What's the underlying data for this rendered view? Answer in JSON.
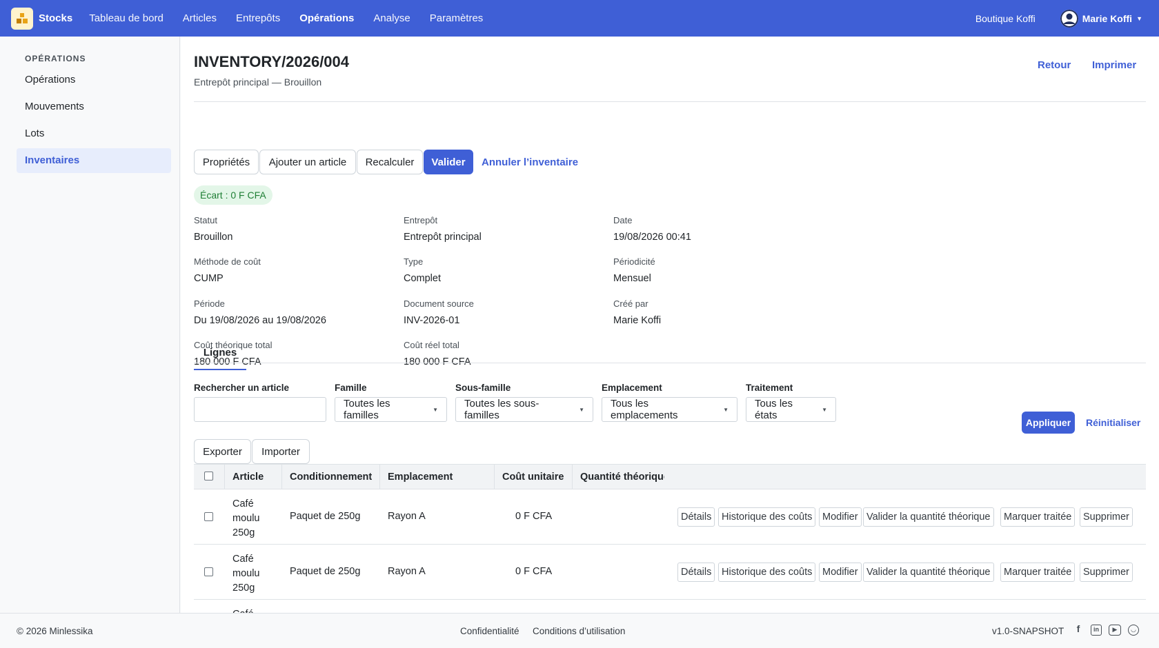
{
  "nav": {
    "brand": "Stocks",
    "links": [
      "Tableau de bord",
      "Articles",
      "Entrepôts",
      "Opérations",
      "Analyse",
      "Paramètres"
    ],
    "active": "Opérations",
    "shop": "Boutique Koffi",
    "user": "Marie Koffi"
  },
  "sidebar": {
    "heading": "OPÉRATIONS",
    "items": [
      "Opérations",
      "Mouvements",
      "Lots",
      "Inventaires"
    ],
    "active": "Inventaires"
  },
  "header": {
    "title": "INVENTORY/2026/004",
    "subtitle": "Entrepôt principal — Brouillon",
    "back": "Retour",
    "print": "Imprimer"
  },
  "actions": {
    "properties": "Propriétés",
    "add_article": "Ajouter un article",
    "recalculate": "Recalculer",
    "validate": "Valider",
    "cancel": "Annuler l’inventaire"
  },
  "gap_badge": "Écart : 0 F CFA",
  "fields": [
    {
      "label": "Statut",
      "value": "Brouillon"
    },
    {
      "label": "Entrepôt",
      "value": "Entrepôt principal"
    },
    {
      "label": "Date",
      "value": "19/08/2026 00:41"
    },
    {
      "label": "Méthode de coût",
      "value": "CUMP"
    },
    {
      "label": "Type",
      "value": "Complet"
    },
    {
      "label": "Périodicité",
      "value": "Mensuel"
    },
    {
      "label": "Période",
      "value": "Du 19/08/2026 au 19/08/2026"
    },
    {
      "label": "Document source",
      "value": "INV-2026-01"
    },
    {
      "label": "Créé par",
      "value": "Marie Koffi"
    },
    {
      "label": "Coût théorique total",
      "value": "180 000 F CFA"
    },
    {
      "label": "Coût réel total",
      "value": "180 000 F CFA"
    }
  ],
  "tab": "Lignes",
  "filters": {
    "search_label": "Rechercher un article",
    "search_value": "",
    "family_label": "Famille",
    "family_value": "Toutes les familles",
    "subfamily_label": "Sous-famille",
    "subfamily_value": "Toutes les sous-familles",
    "location_label": "Emplacement",
    "location_value": "Tous les emplacements",
    "treatment_label": "Traitement",
    "treatment_value": "Tous les états",
    "apply": "Appliquer",
    "reset": "Réinitialiser"
  },
  "table_tools": {
    "export": "Exporter",
    "import": "Importer"
  },
  "table": {
    "columns": [
      "Article",
      "Conditionnement",
      "Emplacement",
      "Coût unitaire",
      "Quantité théorique"
    ],
    "row_actions": [
      "Détails",
      "Historique des coûts",
      "Modifier",
      "Valider la quantité théorique",
      "Marquer traitée",
      "Supprimer"
    ],
    "rows": [
      {
        "article": [
          "Café",
          "moulu",
          "250g"
        ],
        "packaging": "Paquet de 250g",
        "location": "Rayon A",
        "unit_cost": "0 F CFA"
      },
      {
        "article": [
          "Café",
          "moulu",
          "250g"
        ],
        "packaging": "Paquet de 250g",
        "location": "Rayon A",
        "unit_cost": "0 F CFA"
      },
      {
        "article": [
          "Café",
          "",
          ""
        ],
        "packaging": "",
        "location": "",
        "unit_cost": ""
      }
    ]
  },
  "footer": {
    "copyright": "© 2026 Minlessika",
    "privacy": "Confidentialité",
    "terms": "Conditions d’utilisation",
    "version": "v1.0-SNAPSHOT",
    "social_icons": [
      "facebook-icon",
      "linkedin-icon",
      "youtube-icon",
      "github-icon"
    ]
  },
  "colors": {
    "primary": "#3f5fd6",
    "success_bg": "#e3f6e8",
    "success_text": "#1e7e34"
  }
}
